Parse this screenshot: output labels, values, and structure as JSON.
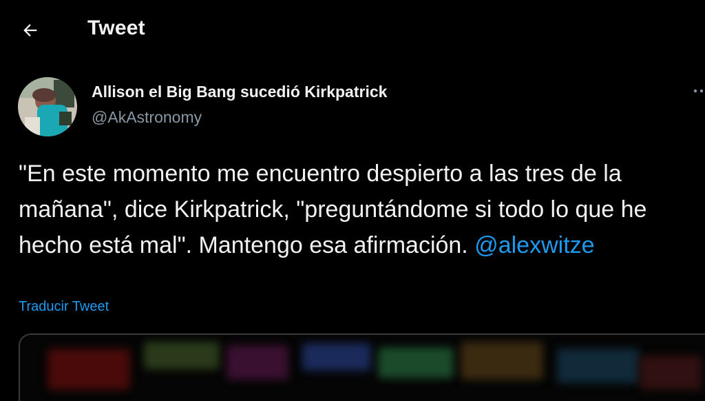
{
  "header": {
    "back_icon": "arrow-left-icon",
    "title": "Tweet"
  },
  "author": {
    "display_name": "Allison el Big Bang sucedió Kirkpatrick",
    "handle": "@AkAstronomy",
    "more_icon": "more-horizontal-icon"
  },
  "tweet": {
    "text": "\"En este momento me encuentro despierto a las tres de la mañana\", dice Kirkpatrick, \"preguntándome si todo lo que he hecho está mal\". Mantengo esa afirmación. ",
    "mention": "@alexwitze",
    "translate_label": "Traducir Tweet"
  },
  "colors": {
    "background": "#000000",
    "text": "#f2f2f2",
    "secondary_text": "#8b98a5",
    "accent": "#1d9bf0"
  }
}
